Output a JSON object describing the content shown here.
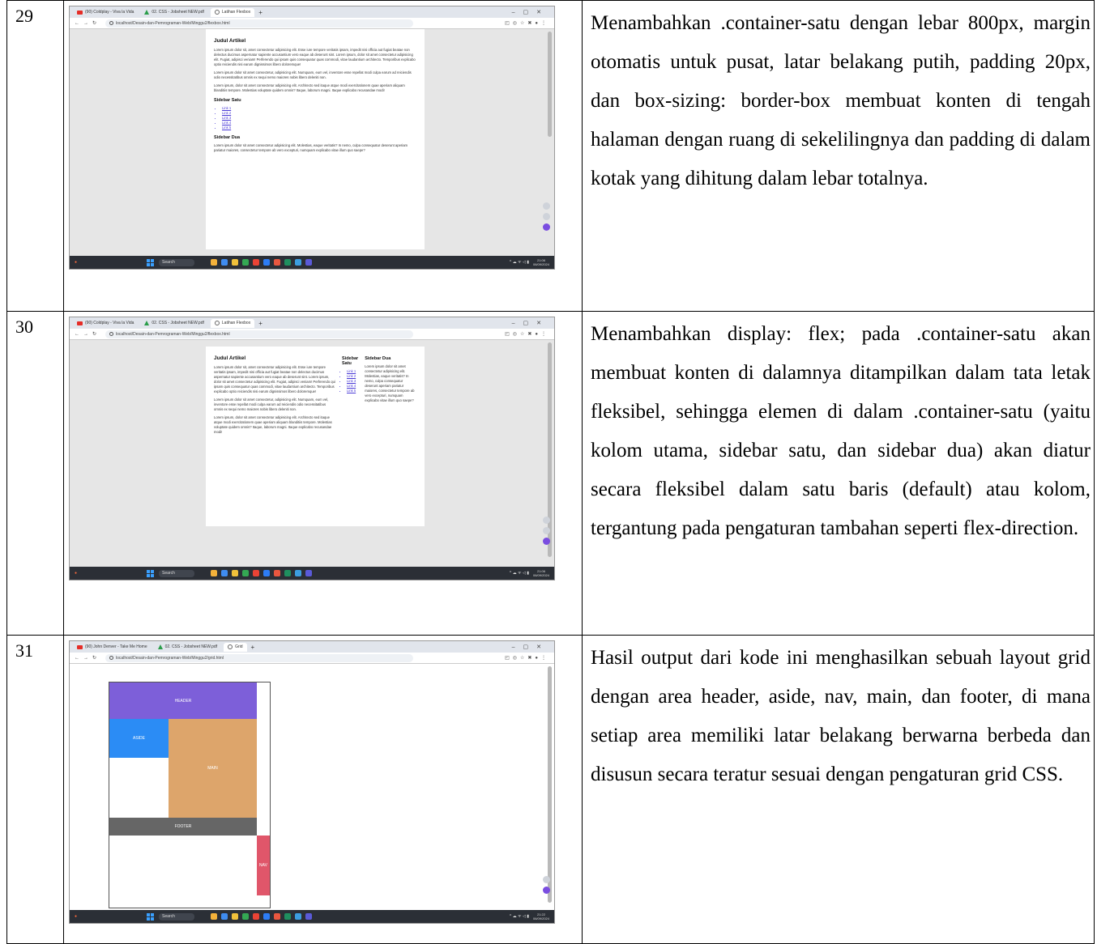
{
  "rows": [
    {
      "number": "29",
      "description": "Menambahkan .container-satu dengan lebar 800px, margin otomatis untuk pusat, latar belakang putih, padding 20px, dan box-sizing: border-box membuat konten di tengah halaman dengan ruang di sekelilingnya dan padding di dalam kotak yang dihitung dalam lebar totalnya.",
      "browser": {
        "tabs": [
          "(90) Coldplay - Viva la Vida",
          "02. CSS - Jobsheet NEW.pdf",
          "Latihan Flexbox"
        ],
        "url": "localhost/Desain-dan-Pemrograman-Web/Minggu2/flexbox.html",
        "clock_time": "21:06",
        "clock_date": "06/09/2024",
        "search": "Search"
      },
      "page": {
        "title": "Judul Artikel",
        "paragraphs": [
          "Lorem ipsum dolor sit, amet consectetur adipisicing elit. Esse iure tempore veritatis ipsam, impedit nisi officia aut fugiat beatae non delectus ducimus aspernatur sapiente accusantium vero eaque ab deserunt sint. Lorem ipsum, dolor sit amet consectetur adipisicing elit. Fugiat, adipisci veniam! Perferendo qui ipsam quis consequatur quas commodi, vitae laudantium architecto. Temporibus explicabo optio reiciendis nisi earum dignissimos libero doloremque!",
          "Lorem ipsum dolor sit amet consectetur, adipisicing elit. Numquam, eum vel, inventore esse repellat modi culpa earum ad reiciendis odio necessitatibus omnis ex sequi nemo maiores nobis libero deleniti non.",
          "Lorem ipsum, dolor sit amet consectetur adipisicing elit. Architecto sed itaque atque modi exercitationem quae aperiam aliquam blanditiis tempore. Molestias voluptate quidem omnis? Itaque, laborum magni. Itaque explicabo recusandae modi!"
        ],
        "sidebar1_title": "Sidebar Satu",
        "links": [
          "Link 1",
          "Link 2",
          "Link 3",
          "Link 4",
          "Link 5"
        ],
        "sidebar2_title": "Sidebar Dua",
        "sidebar2_text": "Lorem ipsum dolor sit amet consectetur adipisicing elit. Molestias, eaque veritatis? In nemo, culpa consequatur deserunt aperiam pariatur maiores, consectetur tempore ab vero excepturi, numquam explicabo vitae illum quo saepe?"
      }
    },
    {
      "number": "30",
      "description": "Menambahkan display: flex; pada .container-satu akan membuat konten di dalamnya ditampilkan dalam tata letak fleksibel, sehingga elemen di dalam .container-satu (yaitu kolom utama, sidebar satu, dan sidebar dua) akan diatur secara fleksibel dalam satu baris (default) atau kolom, tergantung pada pengaturan tambahan seperti flex-direction.",
      "browser": {
        "tabs": [
          "(90) Coldplay - Viva la Vida",
          "02. CSS - Jobsheet NEW.pdf",
          "Latihan Flexbox"
        ],
        "url": "localhost/Desain-dan-Pemrograman-Web/Minggu2/flexbox.html",
        "clock_time": "21:06",
        "clock_date": "06/09/2024",
        "search": "Search"
      },
      "page": {
        "title": "Judul Artikel",
        "paragraphs": [
          "Lorem ipsum dolor sit, amet consectetur adipisicing elit. Esse iure tempore veritatis ipsam, impedit nisi officia aut fugiat beatae non delectus ducimus aspernatur sapiente accusantium vero eaque ab deserunt sint. Lorem ipsum, dolor sit amet consectetur adipisicing elit. Fugiat, adipisci veniam! Perferendo qui ipsam quis consequatur quas commodi, vitae laudantium architecto. Temporibus explicabo optio reiciendis nisi earum dignissimos libero doloremque!",
          "Lorem ipsum dolor sit amet consectetur, adipisicing elit. Numquam, eum vel, inventore esse repellat modi culpa earum ad reiciendis odio necessitatibus omnis ex sequi nemo maiores nobis libero deleniti non.",
          "Lorem ipsum, dolor sit amet consectetur adipisicing elit. Architecto sed itaque atque modi exercitationem quae aperiam aliquam blanditiis tempore. Molestias voluptate quidem omnis? Itaque, laborum magni. Itaque explicabo recusandae modi!"
        ],
        "sidebar1_title": "Sidebar Satu",
        "links": [
          "Link 1",
          "Link 2",
          "Link 3",
          "Link 4",
          "Link 5"
        ],
        "sidebar2_title": "Sidebar Dua",
        "sidebar2_text": "Lorem ipsum dolor sit amet consectetur adipisicing elit. Molestias, eaque veritatis? In nemo, culpa consequatur deserunt aperiam pariatur maiores, consectetur tempore ab vero excepturi, numquam explicabo vitae illum quo saepe?"
      }
    },
    {
      "number": "31",
      "description": "Hasil output dari kode ini menghasilkan sebuah layout grid dengan area header, aside, nav, main, dan footer, di mana setiap area memiliki latar belakang berwarna berbeda dan disusun secara teratur sesuai dengan pengaturan grid CSS.",
      "browser": {
        "tabs": [
          "(90) John Denver - Take Me Home",
          "02. CSS - Jobsheet NEW.pdf",
          "Grid"
        ],
        "url": "localhost/Desain-dan-Pemrograman-Web/Minggu2/grid.html",
        "clock_time": "21:22",
        "clock_date": "06/09/2024",
        "search": "Search"
      },
      "grid": {
        "header": "HEADER",
        "aside": "ASIDE",
        "main": "MAIN",
        "footer": "FOOTER",
        "nav": "NAV",
        "colors": {
          "header": "#7d5fd9",
          "aside": "#2b8cf5",
          "main": "#dda56b",
          "footer": "#666666",
          "nav": "#e0566a"
        }
      }
    }
  ]
}
